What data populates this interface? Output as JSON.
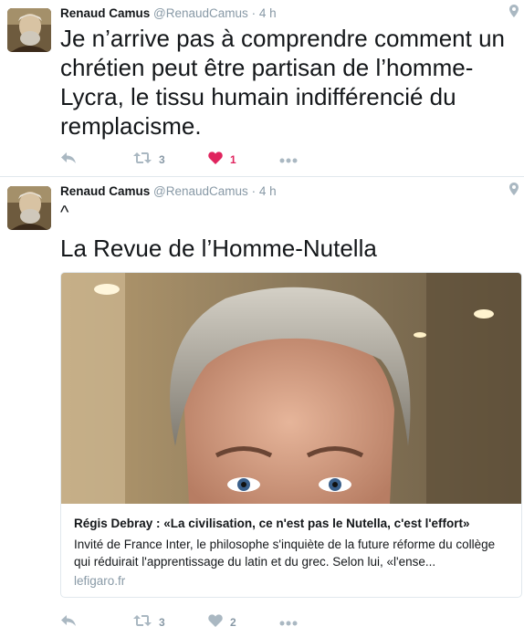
{
  "colors": {
    "accent_like": "#e0245e",
    "muted": "#8899a6",
    "text": "#14171a",
    "divider": "#e1e8ed"
  },
  "tweets": [
    {
      "author_name": "Renaud Camus",
      "handle": "@RenaudCamus",
      "separator": "·",
      "time": "4 h",
      "text": "Je n’arrive pas à comprendre comment un chrétien peut être partisan de  l’homme-Lycra, le tissu humain indifférencié du remplacisme.",
      "retweets": "3",
      "likes": "1",
      "liked": true,
      "icons": [
        "avatar",
        "pin-icon",
        "reply-icon",
        "retweet-icon",
        "heart-icon",
        "more-icon"
      ]
    },
    {
      "author_name": "Renaud Camus",
      "handle": "@RenaudCamus",
      "separator": "·",
      "time": "4 h",
      "caret": "^",
      "text": "La Revue de l’Homme-Nutella",
      "card": {
        "title": "Régis Debray : «La civilisation, ce n'est pas le Nutella, c'est l'effort»",
        "description": "Invité de France Inter, le philosophe s'inquiète de la future réforme du collège qui réduirait l'apprentissage du latin et du grec. Selon lui, «l'ense...",
        "domain": "lefigaro.fr"
      },
      "retweets": "3",
      "likes": "2",
      "liked": false,
      "icons": [
        "avatar",
        "pin-icon",
        "reply-icon",
        "retweet-icon",
        "heart-outline-icon",
        "more-icon"
      ]
    }
  ]
}
